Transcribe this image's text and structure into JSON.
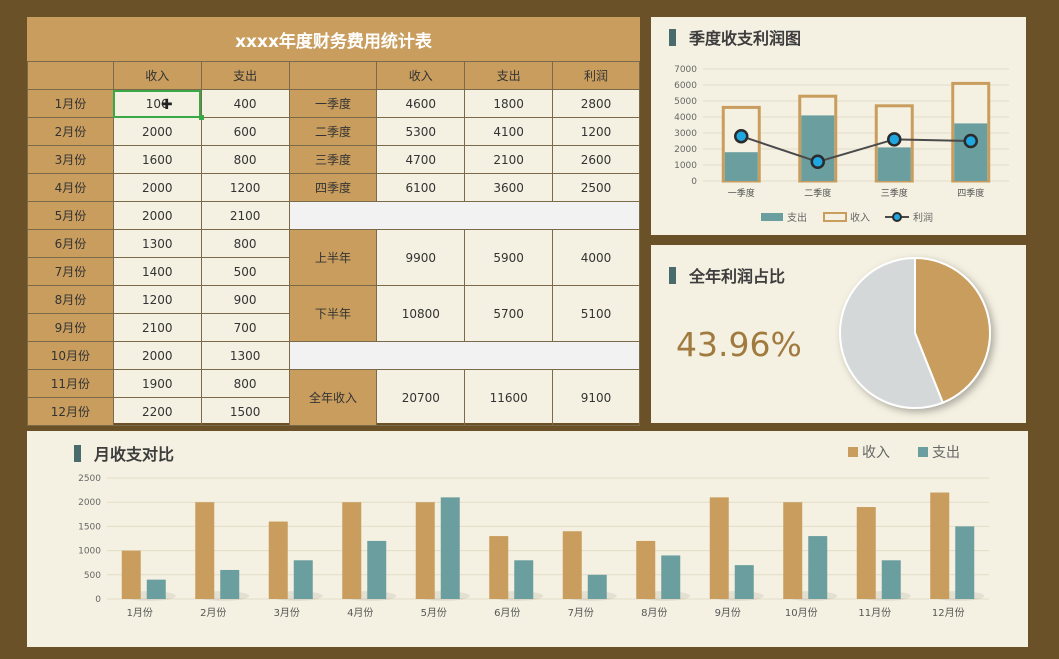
{
  "table": {
    "title": "xxxx年度财务费用统计表",
    "monthly_headers": [
      "收入",
      "支出"
    ],
    "period_headers": [
      "收入",
      "支出",
      "利润"
    ],
    "monthly": [
      {
        "month": "1月份",
        "income": "1000",
        "income_display": "100",
        "expense": "400"
      },
      {
        "month": "2月份",
        "income": "2000",
        "expense": "600"
      },
      {
        "month": "3月份",
        "income": "1600",
        "expense": "800"
      },
      {
        "month": "4月份",
        "income": "2000",
        "expense": "1200"
      },
      {
        "month": "5月份",
        "income": "2000",
        "expense": "2100"
      },
      {
        "month": "6月份",
        "income": "1300",
        "expense": "800"
      },
      {
        "month": "7月份",
        "income": "1400",
        "expense": "500"
      },
      {
        "month": "8月份",
        "income": "1200",
        "expense": "900"
      },
      {
        "month": "9月份",
        "income": "2100",
        "expense": "700"
      },
      {
        "month": "10月份",
        "income": "2000",
        "expense": "1300"
      },
      {
        "month": "11月份",
        "income": "1900",
        "expense": "800"
      },
      {
        "month": "12月份",
        "income": "2200",
        "expense": "1500"
      }
    ],
    "quarters": [
      {
        "label": "一季度",
        "income": "4600",
        "expense": "1800",
        "profit": "2800"
      },
      {
        "label": "二季度",
        "income": "5300",
        "expense": "4100",
        "profit": "1200"
      },
      {
        "label": "三季度",
        "income": "4700",
        "expense": "2100",
        "profit": "2600"
      },
      {
        "label": "四季度",
        "income": "6100",
        "expense": "3600",
        "profit": "2500"
      }
    ],
    "halves": [
      {
        "label": "上半年",
        "income": "9900",
        "expense": "5900",
        "profit": "4000"
      },
      {
        "label": "下半年",
        "income": "10800",
        "expense": "5700",
        "profit": "5100"
      }
    ],
    "annual": {
      "label": "全年收入",
      "income": "20700",
      "expense": "11600",
      "profit": "9100"
    }
  },
  "quarter_chart": {
    "title": "季度收支利润图",
    "legend": [
      "支出",
      "收入",
      "利润"
    ]
  },
  "pie_panel": {
    "title": "全年利润占比",
    "percent_text": "43.96%"
  },
  "monthly_chart": {
    "title": "月收支对比",
    "legend": [
      "收入",
      "支出"
    ]
  },
  "colors": {
    "income": "#c89d5d",
    "expense": "#6b9e9e",
    "profit_line": "#4a4a4a",
    "profit_marker": "#1fa7e0",
    "pie_rest": "#d5d8d8",
    "header": "#c89d5d",
    "background": "#6b5128"
  },
  "chart_data": [
    {
      "type": "bar",
      "title": "季度收支利润图",
      "categories": [
        "一季度",
        "二季度",
        "三季度",
        "四季度"
      ],
      "series": [
        {
          "name": "支出",
          "values": [
            1800,
            4100,
            2100,
            3600
          ]
        },
        {
          "name": "收入",
          "values": [
            4600,
            5300,
            4700,
            6100
          ]
        },
        {
          "name": "利润",
          "values": [
            2800,
            1200,
            2600,
            2500
          ],
          "kind": "line"
        }
      ],
      "ylim": [
        0,
        7000
      ],
      "yticks": [
        0,
        1000,
        2000,
        3000,
        4000,
        5000,
        6000,
        7000
      ],
      "grid": true,
      "legend": "bottom"
    },
    {
      "type": "pie",
      "title": "全年利润占比",
      "slices": [
        {
          "name": "利润",
          "value": 43.96
        },
        {
          "name": "其他",
          "value": 56.04
        }
      ]
    },
    {
      "type": "bar",
      "title": "月收支对比",
      "categories": [
        "1月份",
        "2月份",
        "3月份",
        "4月份",
        "5月份",
        "6月份",
        "7月份",
        "8月份",
        "9月份",
        "10月份",
        "11月份",
        "12月份"
      ],
      "series": [
        {
          "name": "收入",
          "values": [
            1000,
            2000,
            1600,
            2000,
            2000,
            1300,
            1400,
            1200,
            2100,
            2000,
            1900,
            2200
          ]
        },
        {
          "name": "支出",
          "values": [
            400,
            600,
            800,
            1200,
            2100,
            800,
            500,
            900,
            700,
            1300,
            800,
            1500
          ]
        }
      ],
      "ylim": [
        0,
        2500
      ],
      "yticks": [
        0,
        500,
        1000,
        1500,
        2000,
        2500
      ],
      "grid": true,
      "legend": "top-right"
    }
  ]
}
